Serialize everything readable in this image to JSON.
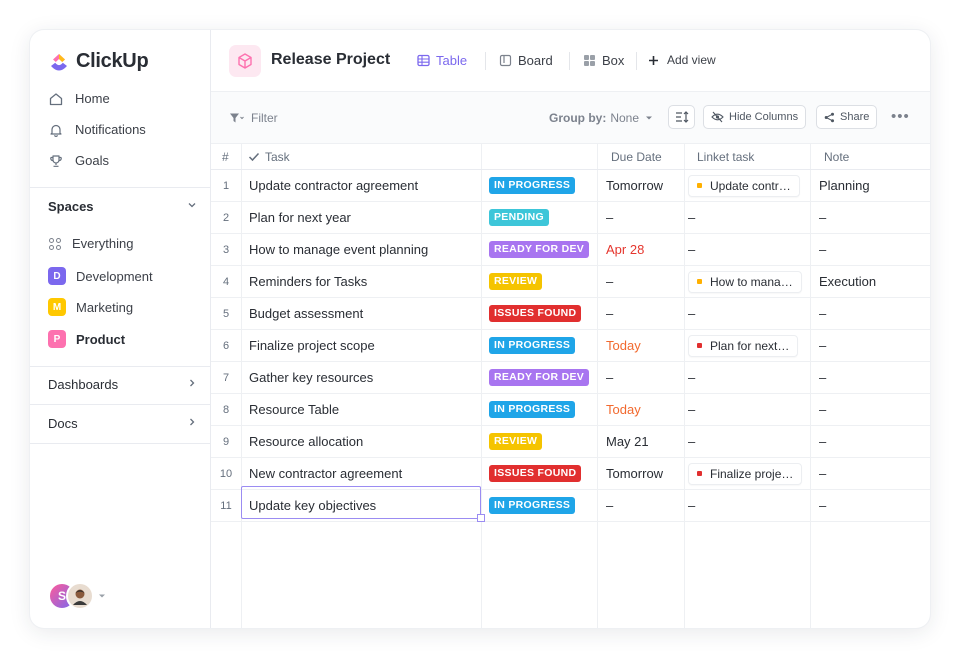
{
  "app": {
    "name": "ClickUp",
    "brand_colors": [
      "#7b68ee",
      "#fd71af",
      "#49ccf9",
      "#ffc800"
    ]
  },
  "sidebar": {
    "nav": [
      {
        "label": "Home",
        "icon": "home-icon"
      },
      {
        "label": "Notifications",
        "icon": "bell-icon"
      },
      {
        "label": "Goals",
        "icon": "trophy-icon"
      }
    ],
    "spaces_label": "Spaces",
    "everything_label": "Everything",
    "spaces": [
      {
        "initial": "D",
        "label": "Development",
        "color": "#7b68ee"
      },
      {
        "initial": "M",
        "label": "Marketing",
        "color": "#ffc800"
      },
      {
        "initial": "P",
        "label": "Product",
        "color": "#fd71af"
      }
    ],
    "dashboards_label": "Dashboards",
    "docs_label": "Docs",
    "user_initial": "S"
  },
  "header": {
    "project_title": "Release Project",
    "views": [
      {
        "label": "Table",
        "icon": "table-icon",
        "active": true
      },
      {
        "label": "Board",
        "icon": "board-icon",
        "active": false
      },
      {
        "label": "Box",
        "icon": "box-icon",
        "active": false
      }
    ],
    "add_view_label": "Add view"
  },
  "toolbar": {
    "filter_label": "Filter",
    "group_by_label": "Group by:",
    "group_by_value": "None",
    "hide_columns_label": "Hide Columns",
    "share_label": "Share"
  },
  "table": {
    "columns": {
      "num": "#",
      "task": "Task",
      "due": "Due Date",
      "linked": "Linket task",
      "note": "Note"
    },
    "rows": [
      {
        "num": "1",
        "task": "Update contractor agreement",
        "status": "IN PROGRESS",
        "status_color": "#1fa5e8",
        "due": "Tomorrow",
        "due_color": "#292d34",
        "linked": "Update contr…",
        "linked_dot": "#ffb000",
        "note": "Planning"
      },
      {
        "num": "2",
        "task": "Plan for next year",
        "status": "PENDING",
        "status_color": "#3dc6d9",
        "due": "–",
        "due_color": "#292d34",
        "linked": "–",
        "linked_dot": "",
        "note": "–"
      },
      {
        "num": "3",
        "task": "How to manage event planning",
        "status": "READY FOR DEV",
        "status_color": "#a875f0",
        "due": "Apr 28",
        "due_color": "#e5362e",
        "linked": "–",
        "linked_dot": "",
        "note": "–"
      },
      {
        "num": "4",
        "task": "Reminders for Tasks",
        "status": "REVIEW",
        "status_color": "#f5c400",
        "due": "–",
        "due_color": "#292d34",
        "linked": "How to mana…",
        "linked_dot": "#ffb000",
        "note": "Execution"
      },
      {
        "num": "5",
        "task": "Budget assessment",
        "status": "ISSUES FOUND",
        "status_color": "#e12f2f",
        "due": "–",
        "due_color": "#292d34",
        "linked": "–",
        "linked_dot": "",
        "note": "–"
      },
      {
        "num": "6",
        "task": "Finalize project scope",
        "status": "IN PROGRESS",
        "status_color": "#1fa5e8",
        "due": "Today",
        "due_color": "#f2692e",
        "linked": "Plan for next…",
        "linked_dot": "#e12f2f",
        "note": "–"
      },
      {
        "num": "7",
        "task": "Gather key resources",
        "status": "READY FOR DEV",
        "status_color": "#a875f0",
        "due": "–",
        "due_color": "#292d34",
        "linked": "–",
        "linked_dot": "",
        "note": "–"
      },
      {
        "num": "8",
        "task": "Resource Table",
        "status": "IN PROGRESS",
        "status_color": "#1fa5e8",
        "due": "Today",
        "due_color": "#f2692e",
        "linked": "–",
        "linked_dot": "",
        "note": "–"
      },
      {
        "num": "9",
        "task": "Resource allocation",
        "status": "REVIEW",
        "status_color": "#f5c400",
        "due": "May 21",
        "due_color": "#292d34",
        "linked": "–",
        "linked_dot": "",
        "note": "–"
      },
      {
        "num": "10",
        "task": "New contractor agreement",
        "status": "ISSUES FOUND",
        "status_color": "#e12f2f",
        "due": "Tomorrow",
        "due_color": "#292d34",
        "linked": "Finalize proje…",
        "linked_dot": "#e12f2f",
        "note": "–"
      },
      {
        "num": "11",
        "task": "Update key objectives",
        "status": "IN PROGRESS",
        "status_color": "#1fa5e8",
        "due": "–",
        "due_color": "#292d34",
        "linked": "–",
        "linked_dot": "",
        "note": "–"
      }
    ]
  }
}
